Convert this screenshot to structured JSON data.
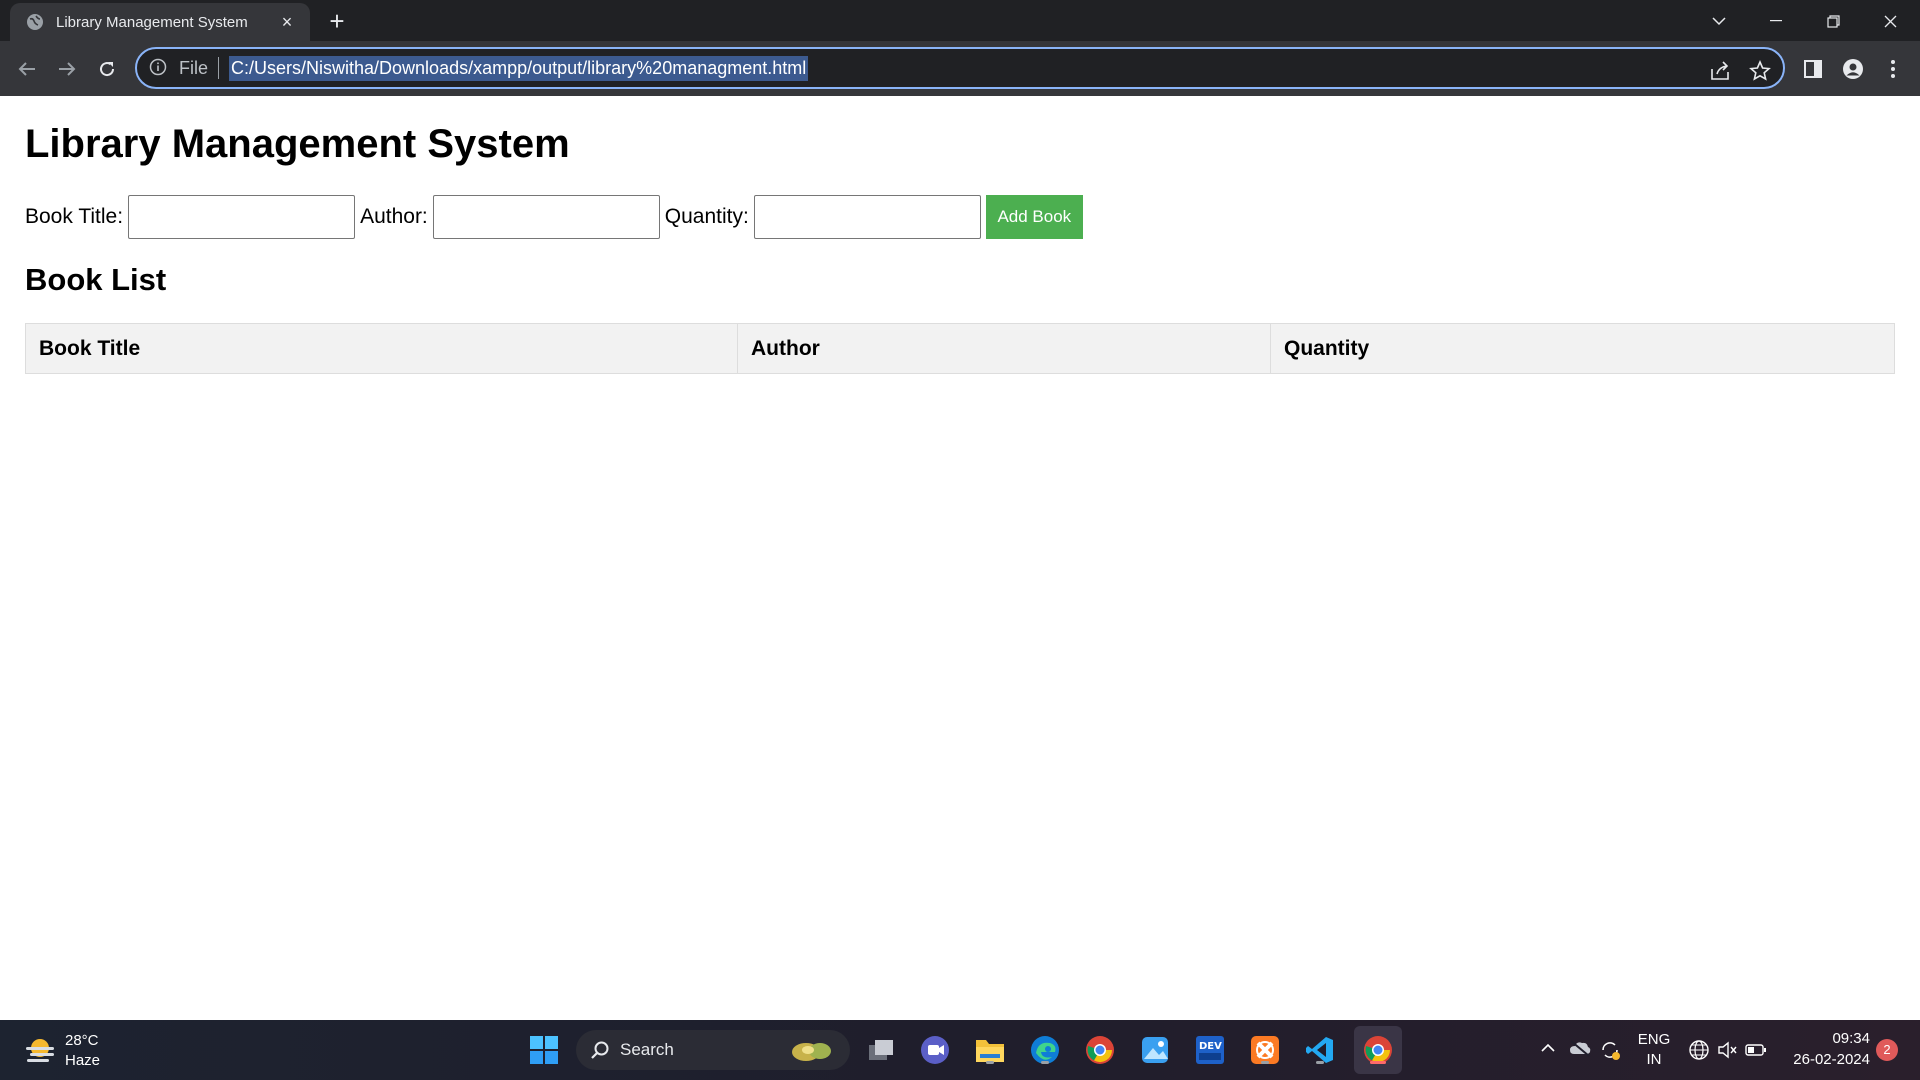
{
  "browser": {
    "tab_title": "Library Management System",
    "new_tab": "+",
    "close_tab": "×",
    "omnibox": {
      "scheme_label": "File",
      "url": "C:/Users/Niswitha/Downloads/xampp/output/library%20managment.html"
    }
  },
  "page": {
    "title": "Library Management System",
    "form": {
      "book_title_label": "Book Title:",
      "author_label": "Author:",
      "quantity_label": "Quantity:",
      "book_title_value": "",
      "author_value": "",
      "quantity_value": "",
      "add_button": "Add Book"
    },
    "book_list_title": "Book List",
    "table": {
      "headers": [
        "Book Title",
        "Author",
        "Quantity"
      ],
      "rows": []
    },
    "accent_color": "#4caf50"
  },
  "taskbar": {
    "weather": {
      "temp": "28°C",
      "desc": "Haze"
    },
    "search_label": "Search",
    "language": {
      "line1": "ENG",
      "line2": "IN"
    },
    "clock": {
      "time": "09:34",
      "date": "26-02-2024"
    },
    "notification_count": "2",
    "pinned_apps": [
      "start-icon",
      "task-view-icon",
      "meet-icon",
      "file-explorer-icon",
      "edge-icon",
      "chrome-icon",
      "photos-icon",
      "devtools-icon",
      "xampp-icon",
      "vscode-icon",
      "chrome-active-icon"
    ]
  }
}
